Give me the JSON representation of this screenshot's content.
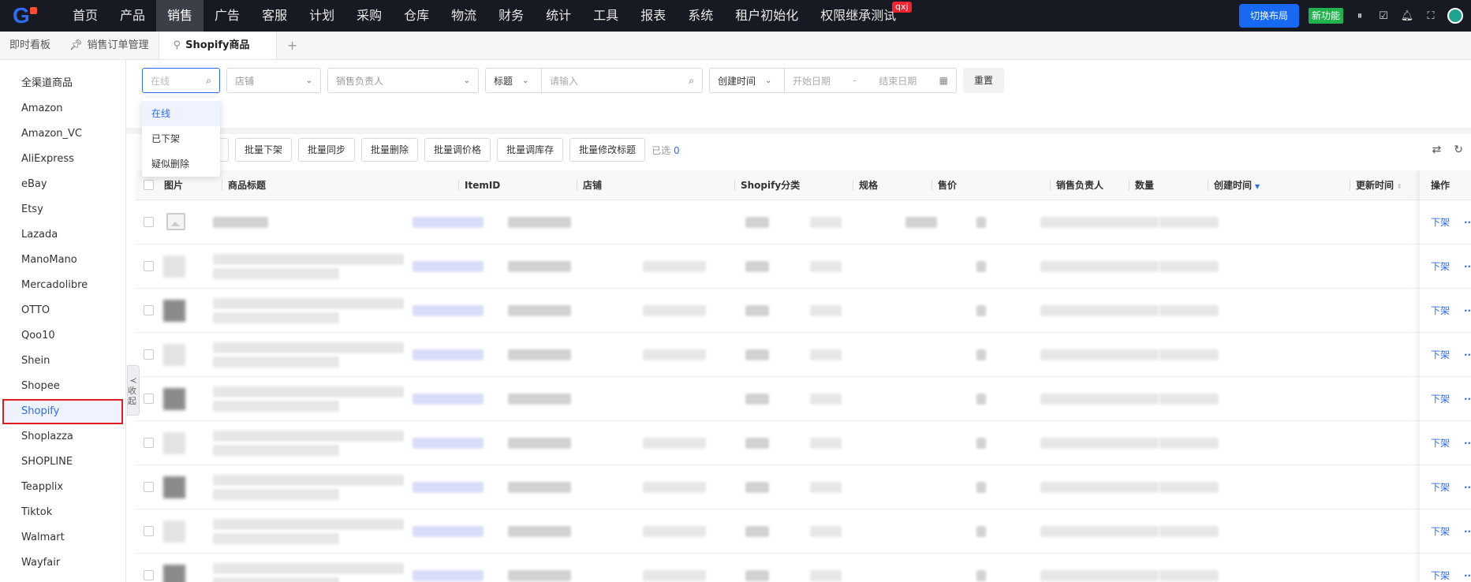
{
  "topnav": {
    "items": [
      "首页",
      "产品",
      "销售",
      "广告",
      "客服",
      "计划",
      "采购",
      "仓库",
      "物流",
      "财务",
      "统计",
      "工具",
      "报表",
      "系统",
      "租户初始化",
      "权限继承测试"
    ],
    "active_index": 2,
    "badge": "qxj",
    "layout_button": "切换布局",
    "new_feature": "新功能"
  },
  "tabs": {
    "items": [
      "即时看板",
      "销售订单管理",
      "Shopify商品"
    ],
    "active_index": 2,
    "add": "+"
  },
  "sidebar": {
    "items": [
      "全渠道商品",
      "Amazon",
      "Amazon_VC",
      "AliExpress",
      "eBay",
      "Etsy",
      "Lazada",
      "ManoMano",
      "Mercadolibre",
      "OTTO",
      "Qoo10",
      "Shein",
      "Shopee",
      "Shopify",
      "Shoplazza",
      "SHOPLINE",
      "Teapplix",
      "Tiktok",
      "Walmart",
      "Wayfair"
    ],
    "active_index": 13,
    "collapse_label": "收起"
  },
  "filters": {
    "status_placeholder": "在线",
    "store_placeholder": "店铺",
    "owner_placeholder": "销售负责人",
    "title_field": "标题",
    "title_placeholder": "请输入",
    "date_field": "创建时间",
    "start_placeholder": "开始日期",
    "date_sep": "-",
    "end_placeholder": "结束日期",
    "reset": "重置"
  },
  "status_dropdown": {
    "options": [
      "在线",
      "已下架",
      "疑似删除"
    ],
    "selected_index": 0
  },
  "batch": {
    "buttons": [
      "批量下架",
      "批量同步",
      "批量删除",
      "批量调价格",
      "批量调库存",
      "批量修改标题"
    ],
    "selected_label": "已选",
    "selected_count": "0"
  },
  "table": {
    "columns": [
      "图片",
      "商品标题",
      "ItemID",
      "店铺",
      "Shopify分类",
      "规格",
      "售价",
      "销售负责人",
      "数量",
      "创建时间",
      "更新时间"
    ],
    "action_header": "操作",
    "row_action": "下架",
    "row_more": "···",
    "row_count": 9
  }
}
